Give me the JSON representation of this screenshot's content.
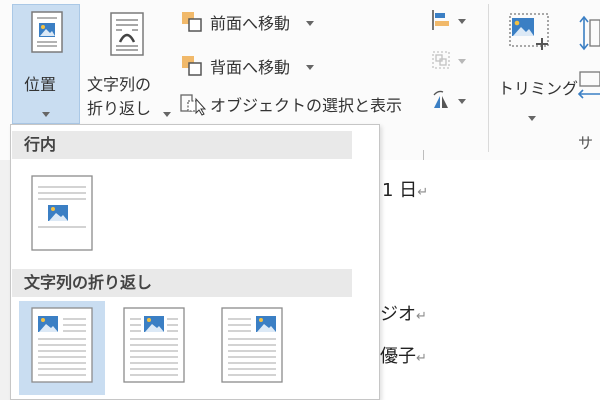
{
  "ribbon": {
    "position": {
      "label": "位置"
    },
    "wrap_text": {
      "label_line1": "文字列の",
      "label_line2": "折り返し"
    },
    "bring_forward": {
      "label": "前面へ移動"
    },
    "send_backward": {
      "label": "背面へ移動"
    },
    "selection_pane": {
      "label": "オブジェクトの選択と表示"
    },
    "crop": {
      "label": "トリミング"
    },
    "size_group_label": "サ"
  },
  "document": {
    "lines": [
      {
        "text": "1 日"
      },
      {
        "text": "ジオ"
      },
      {
        "text": "優子"
      }
    ],
    "paragraph_mark": "↵"
  },
  "position_menu": {
    "inline_section": {
      "title": "行内"
    },
    "wrap_section": {
      "title": "文字列の折り返し"
    },
    "selected_option_index": 0
  },
  "colors": {
    "accent_selected": "#c9ddf1",
    "arrange_orange": "#f1b96a",
    "image_blue": "#3b7fc4",
    "sun_yellow": "#f4c142"
  }
}
